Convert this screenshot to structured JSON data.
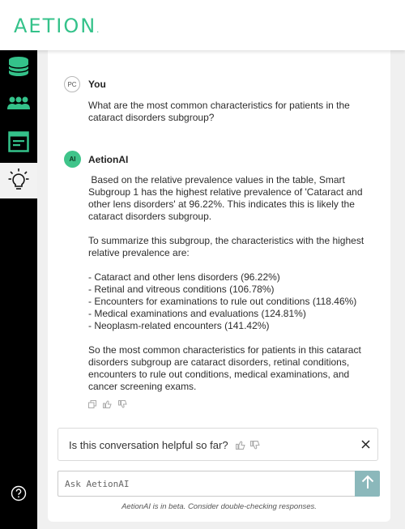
{
  "brand": {
    "logo_text": "AETION",
    "logo_mark": "."
  },
  "sidebar": {
    "items": [
      {
        "name": "database",
        "icon": "database-icon"
      },
      {
        "name": "cohorts",
        "icon": "people-icon"
      },
      {
        "name": "reports",
        "icon": "document-icon"
      },
      {
        "name": "insights",
        "icon": "lightbulb-icon",
        "active": true
      }
    ],
    "help_icon": "help-icon"
  },
  "conversation": {
    "user": {
      "initials": "PC",
      "name": "You",
      "message": "What are the most common characteristics for patients in the cataract disorders subgroup?"
    },
    "assistant": {
      "initials": "AI",
      "name": "AetionAI",
      "paragraph1": " Based on the relative prevalence values in the table, Smart Subgroup 1 has the highest relative prevalence of 'Cataract and other lens disorders' at 96.22%. This indicates this is likely the cataract disorders subgroup.",
      "paragraph2": "To summarize this subgroup, the characteristics with the highest relative prevalence are:",
      "list": [
        "- Cataract and other lens disorders (96.22%)",
        "- Retinal and vitreous conditions (106.78%)",
        "- Encounters for examinations to rule out conditions (118.46%)",
        "- Medical examinations and evaluations (124.81%)",
        "- Neoplasm-related encounters (141.42%)"
      ],
      "paragraph3": "So the most common characteristics for patients in this cataract disorders subgroup are cataract disorders, retinal conditions, encounters to rule out conditions, medical examinations, and cancer screening exams."
    }
  },
  "feedback": {
    "question": "Is this conversation helpful so far?"
  },
  "composer": {
    "placeholder": "Ask AetionAI"
  },
  "footer": {
    "beta_note": "AetionAI is in beta. Consider double-checking responses."
  },
  "colors": {
    "accent": "#34c28a",
    "send_button": "#8bb8bb",
    "sidebar_bg": "#000000"
  }
}
